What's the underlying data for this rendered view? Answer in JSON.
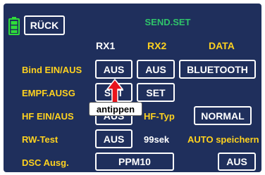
{
  "header": {
    "back_label": "RÜCK",
    "title": "SEND.SET",
    "battery_icon": "battery-icon"
  },
  "columns": {
    "rx1": "RX1",
    "rx2": "RX2",
    "data": "DATA"
  },
  "rows": {
    "bind": {
      "label": "Bind EIN/AUS",
      "rx1": "AUS",
      "rx2": "AUS",
      "data": "BLUETOOTH"
    },
    "empf": {
      "label": "EMPF.AUSG",
      "rx1": "SET",
      "rx2": "SET"
    },
    "hf": {
      "label": "HF EIN/AUS",
      "rx1": "AUS",
      "typ_label": "HF-Typ",
      "typ_value": "NORMAL"
    },
    "rw": {
      "label": "RW-Test",
      "rx1": "AUS",
      "time": "99sek",
      "auto_label": "AUTO speichern"
    },
    "dsc": {
      "label": "DSC Ausg.",
      "mode": "PPM10",
      "auto": "AUS"
    }
  },
  "callout": {
    "text": "antippen",
    "arrow_icon": "arrow-up-icon"
  },
  "colors": {
    "background": "#1f2f5c",
    "label_yellow": "#ffd21f",
    "title_green": "#2fc46a",
    "rx1_white": "#ffffff",
    "battery_green": "#2fdc3a",
    "arrow_red": "#e8141c"
  }
}
